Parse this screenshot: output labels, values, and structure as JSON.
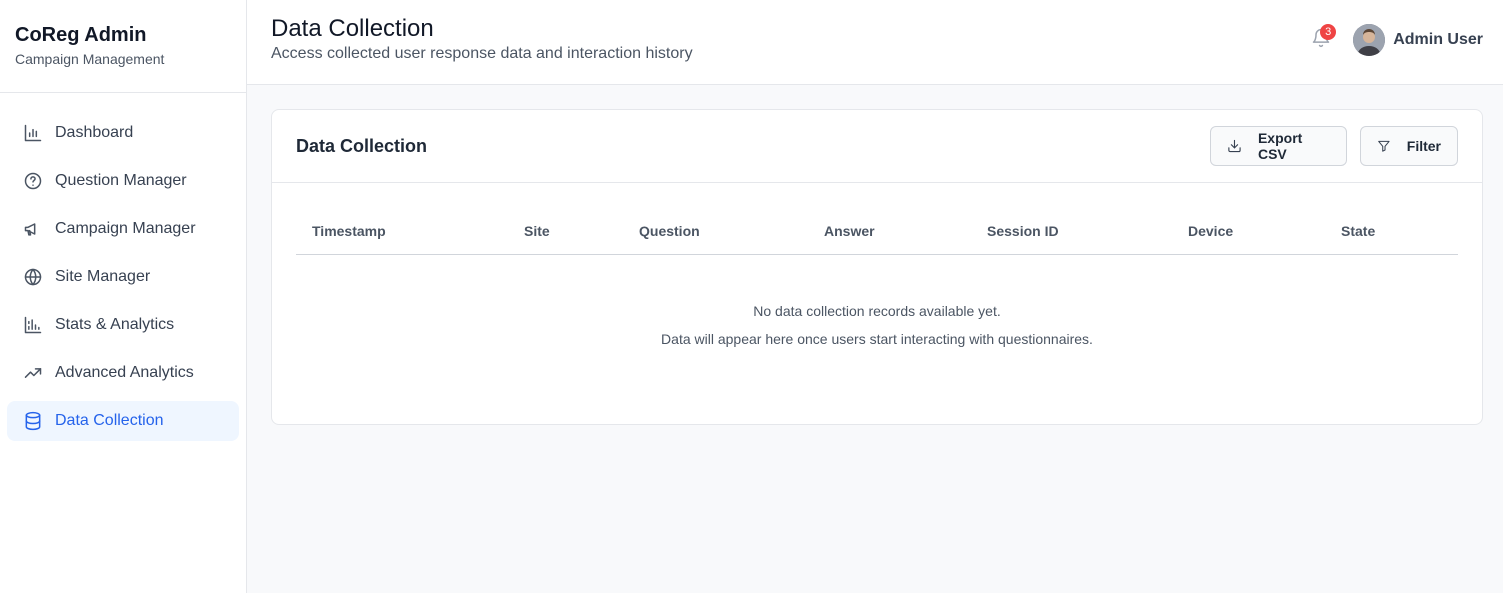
{
  "brand": {
    "title": "CoReg Admin",
    "subtitle": "Campaign Management"
  },
  "sidebar": {
    "items": [
      {
        "label": "Dashboard",
        "icon": "bar-chart-icon",
        "active": false
      },
      {
        "label": "Question Manager",
        "icon": "help-circle-icon",
        "active": false
      },
      {
        "label": "Campaign Manager",
        "icon": "megaphone-icon",
        "active": false
      },
      {
        "label": "Site Manager",
        "icon": "globe-icon",
        "active": false
      },
      {
        "label": "Stats & Analytics",
        "icon": "chart-icon",
        "active": false
      },
      {
        "label": "Advanced Analytics",
        "icon": "trending-up-icon",
        "active": false
      },
      {
        "label": "Data Collection",
        "icon": "database-icon",
        "active": true
      }
    ]
  },
  "header": {
    "title": "Data Collection",
    "subtitle": "Access collected user response data and interaction history",
    "notifications_count": "3",
    "user_name": "Admin User"
  },
  "card": {
    "title": "Data Collection",
    "export_label": "Export CSV",
    "filter_label": "Filter",
    "columns": [
      "Timestamp",
      "Site",
      "Question",
      "Answer",
      "Session ID",
      "Device",
      "State"
    ],
    "empty_line1": "No data collection records available yet.",
    "empty_line2": "Data will appear here once users start interacting with questionnaires."
  },
  "colors": {
    "accent": "#2563eb",
    "active_bg": "#eff6ff",
    "badge": "#ef4444"
  }
}
